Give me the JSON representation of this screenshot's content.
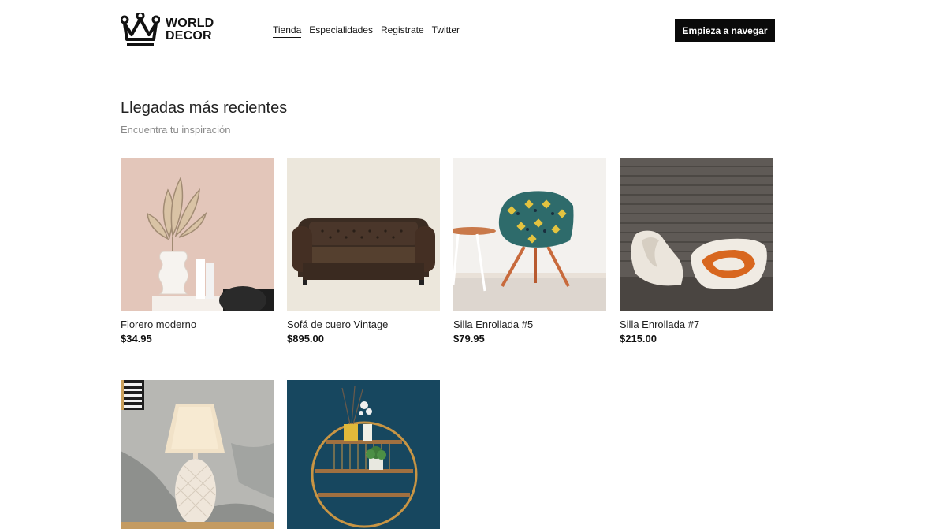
{
  "brand": {
    "line1": "WORLD",
    "line2": "DECOR",
    "icon": "crown-icon"
  },
  "nav": {
    "items": [
      {
        "label": "Tienda",
        "active": true
      },
      {
        "label": "Especialidades",
        "active": false
      },
      {
        "label": "Registrate",
        "active": false
      },
      {
        "label": "Twitter",
        "active": false
      }
    ]
  },
  "header": {
    "cta_label": "Empieza a navegar"
  },
  "section": {
    "title": "Llegadas más recientes",
    "subtitle": "Encuentra tu inspiración"
  },
  "products": [
    {
      "name": "Florero moderno",
      "price": "$34.95",
      "image": "vase-image"
    },
    {
      "name": "Sofá de cuero Vintage",
      "price": "$895.00",
      "image": "leather-sofa-image"
    },
    {
      "name": "Silla Enrollada #5",
      "price": "$79.95",
      "image": "patterned-chair-image"
    },
    {
      "name": "Silla Enrollada #7",
      "price": "$215.00",
      "image": "curved-chairs-image"
    },
    {
      "name": "",
      "price": "",
      "image": "pineapple-lamp-image"
    },
    {
      "name": "",
      "price": "",
      "image": "round-shelf-image"
    }
  ],
  "colors": {
    "cta_background": "#0a0a0a",
    "cta_text": "#ffffff",
    "subtitle": "#8a8a8a"
  }
}
